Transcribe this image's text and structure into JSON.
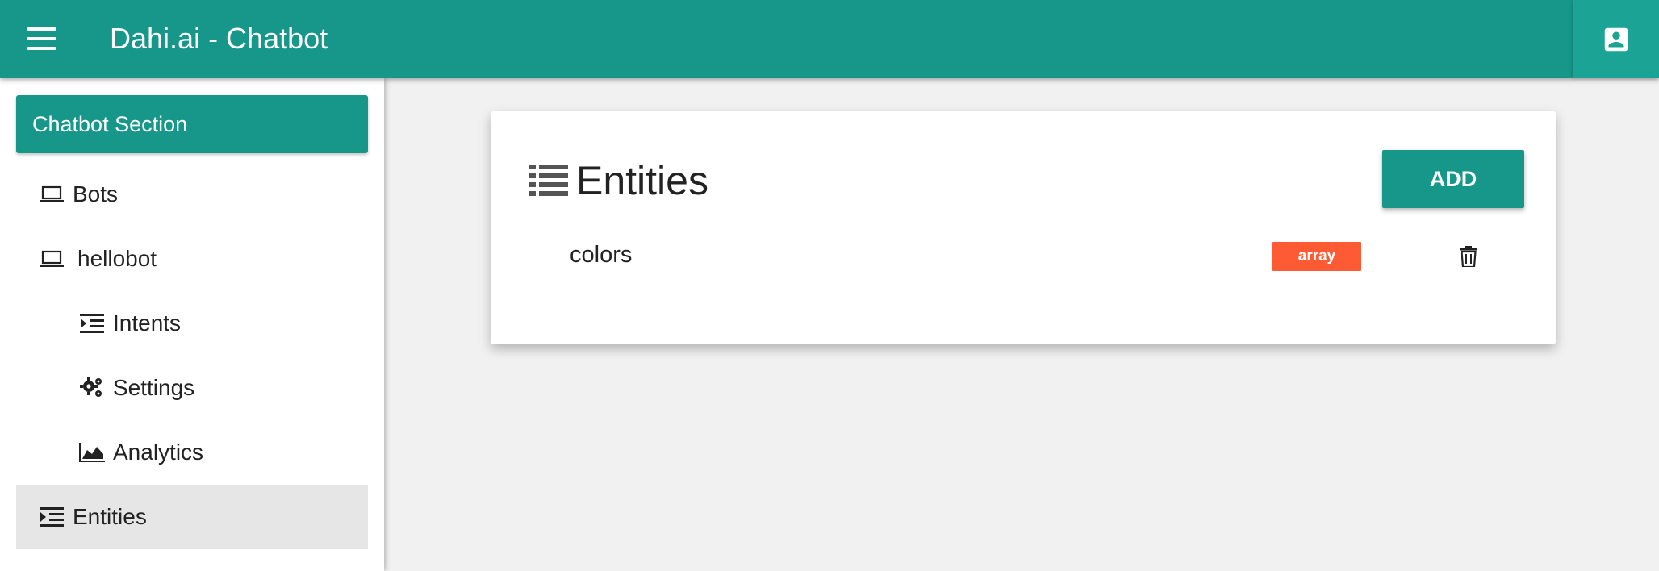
{
  "app": {
    "title": "Dahi.ai - Chatbot"
  },
  "icons": {
    "menu": "menu-icon",
    "account": "account-box-icon",
    "laptop": "laptop-icon",
    "indent": "format-indent-icon",
    "gears": "gears-icon",
    "area_chart": "area-chart-icon",
    "list": "list-icon",
    "trash": "trash-icon"
  },
  "colors": {
    "primary": "#17978a",
    "badge": "#fe5a33",
    "active_item": "#e6e6e6"
  },
  "sidebar": {
    "section_title": "Chatbot Section",
    "items": [
      {
        "label": "Bots"
      },
      {
        "label": "hellobot"
      },
      {
        "label": "Intents"
      },
      {
        "label": "Settings"
      },
      {
        "label": "Analytics"
      },
      {
        "label": "Entities"
      }
    ]
  },
  "main": {
    "title": "Entities",
    "add_label": "ADD",
    "entities": [
      {
        "name": "colors",
        "type": "array"
      }
    ]
  }
}
